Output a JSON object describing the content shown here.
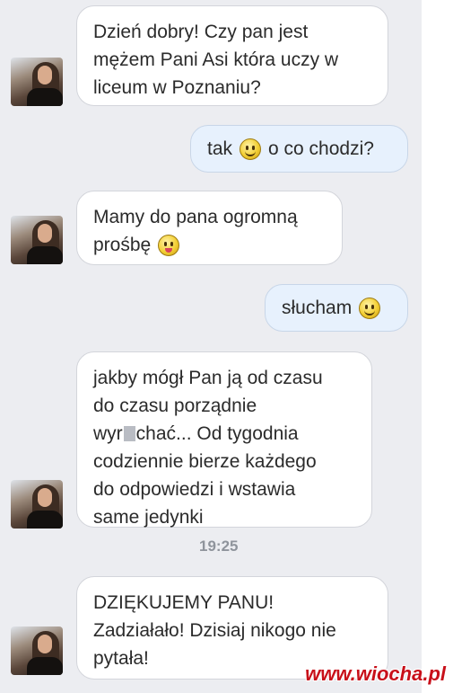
{
  "messages": [
    {
      "lines": [
        "Dzień dobry! Czy pan jest",
        "mężem Pani Asi która uczy w",
        "liceum w Poznaniu?"
      ]
    },
    {
      "before": "tak",
      "after": "o co chodzi?",
      "emoji": "smile-emoji-icon"
    },
    {
      "lines": [
        "Mamy do pana ogromną"
      ],
      "last_line": "prośbę",
      "emoji": "tongue-emoji-icon"
    },
    {
      "before": "słucham",
      "emoji": "smile-emoji-icon"
    },
    {
      "lines": [
        "jakby mógł Pan ją od czasu",
        "do czasu porządnie"
      ],
      "redacted_pre": "wyr",
      "redacted_post": "chać... Od tygodnia",
      "lines2": [
        "codziennie bierze każdego",
        "do odpowiedzi i wstawia",
        "same jedynki"
      ]
    },
    {
      "lines": [
        "DZIĘKUJEMY PANU!",
        "Zadziałało! Dzisiaj nikogo nie",
        "pytała!"
      ]
    }
  ],
  "timestamp": "19:25",
  "watermark": "www.wiocha.pl"
}
